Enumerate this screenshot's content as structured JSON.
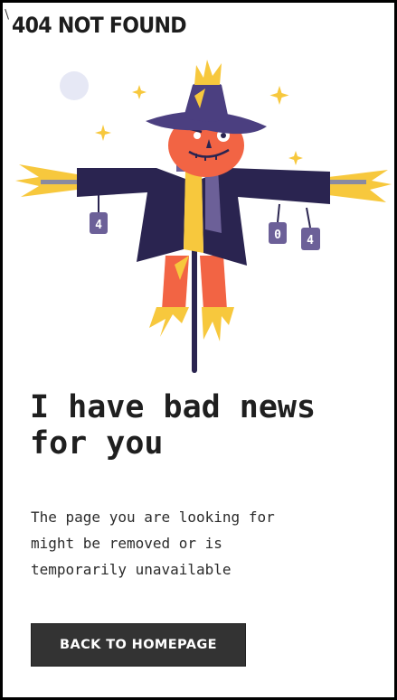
{
  "header": {
    "brand": "404 NOT FOUND"
  },
  "illustration": {
    "can_left_digit": "4",
    "can_middle_digit": "0",
    "can_right_digit": "4"
  },
  "main": {
    "headline": "I have bad news for you",
    "description": "The page you are looking for might be removed or is temporarily unavailable",
    "button_label": "BACK TO HOMEPAGE"
  },
  "colors": {
    "hat": "#4b3f80",
    "coat": "#2a2450",
    "face": "#f26444",
    "straw": "#f7c83d",
    "can": "#6c6098",
    "button_bg": "#333333",
    "moon": "#e6e8f5"
  }
}
